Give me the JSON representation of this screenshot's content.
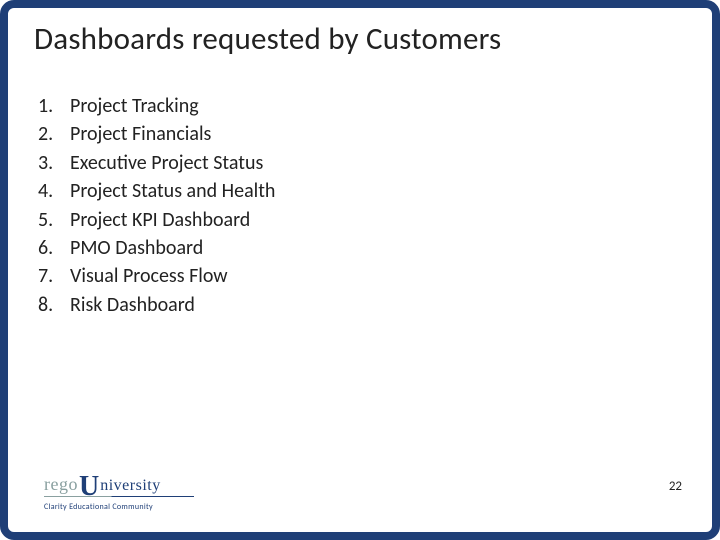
{
  "title": "Dashboards requested by Customers",
  "list": [
    {
      "num": "1.",
      "label": "Project Tracking"
    },
    {
      "num": "2.",
      "label": "Project Financials"
    },
    {
      "num": "3.",
      "label": "Executive Project Status"
    },
    {
      "num": "4.",
      "label": "Project Status and Health"
    },
    {
      "num": "5.",
      "label": "Project KPI Dashboard"
    },
    {
      "num": "6.",
      "label": "PMO Dashboard"
    },
    {
      "num": "7.",
      "label": "Visual Process Flow"
    },
    {
      "num": "8.",
      "label": "Risk Dashboard"
    }
  ],
  "footer": {
    "logo_rego": "rego",
    "logo_u": "U",
    "logo_rest": "niversity",
    "tagline": "Clarity Educational Community"
  },
  "page_number": "22"
}
